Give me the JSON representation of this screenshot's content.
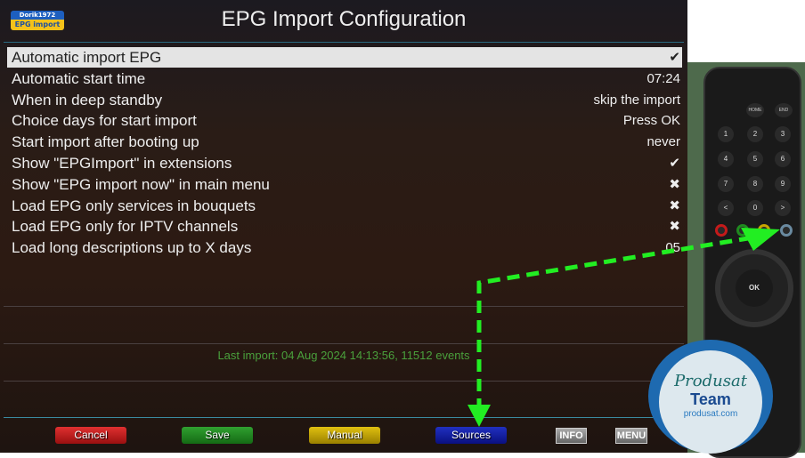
{
  "header": {
    "title": "EPG Import Configuration",
    "logo_top": "Dorik1972",
    "logo_bottom": "EPG import"
  },
  "settings": [
    {
      "label": "Automatic import EPG",
      "value": "✔",
      "selected": true
    },
    {
      "label": "Automatic start time",
      "value": "07:24"
    },
    {
      "label": "When in deep standby",
      "value": "skip the import"
    },
    {
      "label": "Choice days for start import",
      "value": "Press OK"
    },
    {
      "label": "Start import after booting up",
      "value": "never"
    },
    {
      "label": "Show \"EPGImport\" in extensions",
      "value": "✔"
    },
    {
      "label": "Show \"EPG import now\" in main menu",
      "value": "✖"
    },
    {
      "label": "Load EPG only services in bouquets",
      "value": "✖"
    },
    {
      "label": "Load EPG only for IPTV channels",
      "value": "✖"
    },
    {
      "label": "Load long descriptions up to X days",
      "value": "05"
    }
  ],
  "status": {
    "last_import": "Last import: 04 Aug 2024 14:13:56, 11512 events"
  },
  "buttons": {
    "cancel": "Cancel",
    "save": "Save",
    "manual": "Manual",
    "sources": "Sources",
    "info": "INFO",
    "menu": "MENU"
  },
  "colors": {
    "red": "#c41a1a",
    "green": "#1f8a1f",
    "yellow": "#c8a400",
    "blue": "#10189a",
    "arrow": "#22ee22"
  },
  "remote": {
    "keys": [
      "1",
      "2",
      "3",
      "4",
      "5",
      "6",
      "7",
      "8",
      "9",
      "<",
      "0",
      ">",
      "OK",
      "HOME",
      "END"
    ]
  },
  "watermark": {
    "line1": "Produsat",
    "line2": "Team",
    "line3": "produsat.com"
  }
}
